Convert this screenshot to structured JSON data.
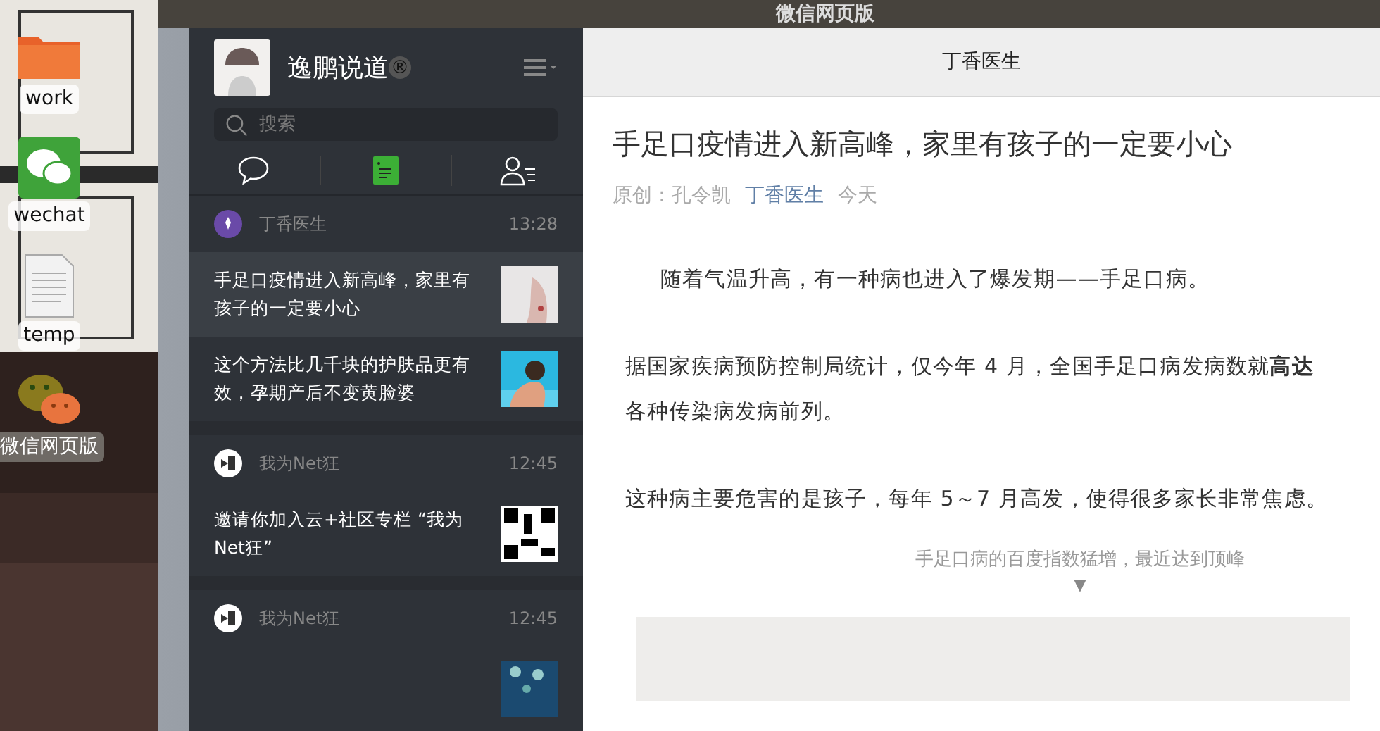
{
  "desktop": {
    "icons": [
      {
        "kind": "folder",
        "label": "work",
        "selected": false
      },
      {
        "kind": "wechat",
        "label": "wechat",
        "selected": false
      },
      {
        "kind": "document",
        "label": "temp",
        "selected": false
      },
      {
        "kind": "webapp",
        "label": "微信网页版",
        "selected": true
      }
    ]
  },
  "window": {
    "title": "微信网页版"
  },
  "sidebar": {
    "user": {
      "name": "逸鹏说道",
      "badge": "®"
    },
    "search": {
      "placeholder": "搜索"
    },
    "tabs": [
      {
        "kind": "chat",
        "selected": false
      },
      {
        "kind": "articles",
        "selected": true
      },
      {
        "kind": "contacts",
        "selected": false
      }
    ],
    "groups": [
      {
        "kind": "health",
        "account": "丁香医生",
        "time": "13:28",
        "items": [
          {
            "title": "手足口疫情进入新高峰，家里有孩子的一定要小心",
            "selected": true
          },
          {
            "title": "这个方法比几千块的护肤品更有效，孕期产后不变黄脸婆",
            "selected": false
          }
        ]
      },
      {
        "kind": "dotnet",
        "account": "我为Net狂",
        "time": "12:45",
        "items": [
          {
            "title": "邀请你加入云+社区专栏 “我为Net狂”",
            "selected": false
          }
        ]
      },
      {
        "kind": "dotnet",
        "account": "我为Net狂",
        "time": "12:45",
        "items": [
          {
            "selected": false
          }
        ]
      }
    ]
  },
  "article": {
    "header": "丁香医生",
    "title": "手足口疫情进入新高峰，家里有孩子的一定要小心",
    "meta": {
      "prefix": "原创：",
      "author": "孔令凯",
      "account": "丁香医生",
      "date": "今天"
    },
    "paragraphs": [
      {
        "kind": "indent",
        "lines": [
          "随着气温升高，有一种病也进入了爆发期——手足口病。"
        ]
      },
      {
        "kind": "plain",
        "lines": [
          "据国家疾病预防控制局统计，仅今年 4 月，全国手足口病发病数就**高达**",
          "各种传染病发病前列。"
        ]
      },
      {
        "kind": "plain",
        "lines": [
          "这种病主要危害的是孩子，每年 5～7 月高发，使得很多家长非常焦虑。"
        ]
      }
    ],
    "caption": "手足口病的百度指数猛增，最近达到顶峰",
    "caption_arrow": "▼"
  }
}
